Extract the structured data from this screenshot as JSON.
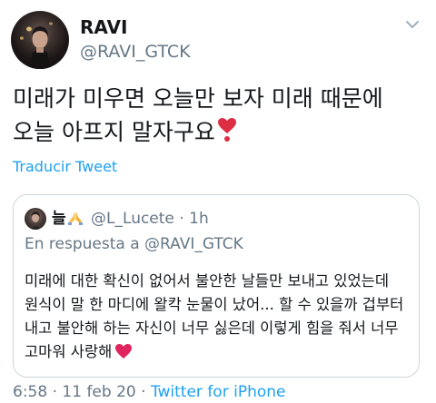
{
  "tweet": {
    "display_name": "RAVI",
    "handle": "@RAVI_GTCK",
    "text": "미래가 미우면 오늘만 보자 미래 때문에 오늘 아프지 말자구요",
    "translate_label": "Traducir Tweet"
  },
  "quoted": {
    "name": "늘",
    "handle": "@L_Lucete",
    "separator": "·",
    "time": "1h",
    "reply_prefix": "En respuesta a",
    "reply_to": "@RAVI_GTCK",
    "text": "미래에 대한 확신이 없어서 불안한 날들만 보내고 있었는데 원식이 말 한 마디에 왈칵 눈물이 났어... 할 수 있을까 겁부터 내고 불안해 하는 자신이 너무 싫은데 이렇게 힘을 줘서 너무 고마워 사랑해"
  },
  "footer": {
    "time": "6:58",
    "date": "11 feb 20",
    "separator": "·",
    "source": "Twitter for iPhone"
  },
  "icons": {
    "caret": "chevron-down-icon",
    "tweet_emoji": "red-heart-exclamation-icon",
    "name_emoji": "praying-hands-icon",
    "quote_emoji": "red-heart-icon"
  },
  "colors": {
    "link": "#1da1f2",
    "muted": "#657786",
    "border": "#ccd6dd",
    "heart": "#e0245e"
  }
}
